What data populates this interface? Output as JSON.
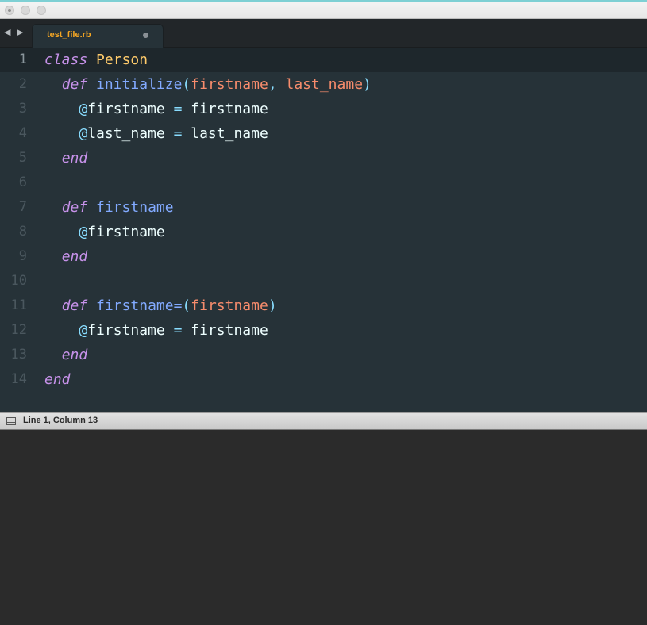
{
  "window": {
    "controls": [
      "close",
      "minimize",
      "zoom"
    ]
  },
  "tabbar": {
    "back_icon": "◀",
    "forward_icon": "▶",
    "active_tab": {
      "label": "test_file.rb",
      "modified": true
    }
  },
  "editor": {
    "current_line": 1,
    "lines": [
      {
        "n": "1",
        "tokens": [
          {
            "t": "kw",
            "v": "class"
          },
          {
            "t": "plain",
            "v": " "
          },
          {
            "t": "cls",
            "v": "Person"
          }
        ]
      },
      {
        "n": "2",
        "tokens": [
          {
            "t": "plain",
            "v": "  "
          },
          {
            "t": "kw",
            "v": "def"
          },
          {
            "t": "plain",
            "v": " "
          },
          {
            "t": "fn",
            "v": "initialize"
          },
          {
            "t": "punc",
            "v": "("
          },
          {
            "t": "param",
            "v": "firstname"
          },
          {
            "t": "punc",
            "v": ","
          },
          {
            "t": "plain",
            "v": " "
          },
          {
            "t": "param",
            "v": "last_name"
          },
          {
            "t": "punc",
            "v": ")"
          }
        ]
      },
      {
        "n": "3",
        "tokens": [
          {
            "t": "plain",
            "v": "    "
          },
          {
            "t": "ivar-at",
            "v": "@"
          },
          {
            "t": "plain",
            "v": "firstname "
          },
          {
            "t": "op",
            "v": "="
          },
          {
            "t": "plain",
            "v": " firstname"
          }
        ]
      },
      {
        "n": "4",
        "tokens": [
          {
            "t": "plain",
            "v": "    "
          },
          {
            "t": "ivar-at",
            "v": "@"
          },
          {
            "t": "plain",
            "v": "last_name "
          },
          {
            "t": "op",
            "v": "="
          },
          {
            "t": "plain",
            "v": " last_name"
          }
        ]
      },
      {
        "n": "5",
        "tokens": [
          {
            "t": "plain",
            "v": "  "
          },
          {
            "t": "kw",
            "v": "end"
          }
        ]
      },
      {
        "n": "6",
        "tokens": []
      },
      {
        "n": "7",
        "tokens": [
          {
            "t": "plain",
            "v": "  "
          },
          {
            "t": "kw",
            "v": "def"
          },
          {
            "t": "plain",
            "v": " "
          },
          {
            "t": "fn",
            "v": "firstname"
          }
        ]
      },
      {
        "n": "8",
        "tokens": [
          {
            "t": "plain",
            "v": "    "
          },
          {
            "t": "ivar-at",
            "v": "@"
          },
          {
            "t": "plain",
            "v": "firstname"
          }
        ]
      },
      {
        "n": "9",
        "tokens": [
          {
            "t": "plain",
            "v": "  "
          },
          {
            "t": "kw",
            "v": "end"
          }
        ]
      },
      {
        "n": "10",
        "tokens": []
      },
      {
        "n": "11",
        "tokens": [
          {
            "t": "plain",
            "v": "  "
          },
          {
            "t": "kw",
            "v": "def"
          },
          {
            "t": "plain",
            "v": " "
          },
          {
            "t": "fn",
            "v": "firstname="
          },
          {
            "t": "punc",
            "v": "("
          },
          {
            "t": "param",
            "v": "firstname"
          },
          {
            "t": "punc",
            "v": ")"
          }
        ]
      },
      {
        "n": "12",
        "tokens": [
          {
            "t": "plain",
            "v": "    "
          },
          {
            "t": "ivar-at",
            "v": "@"
          },
          {
            "t": "plain",
            "v": "firstname "
          },
          {
            "t": "op",
            "v": "="
          },
          {
            "t": "plain",
            "v": " firstname"
          }
        ]
      },
      {
        "n": "13",
        "tokens": [
          {
            "t": "plain",
            "v": "  "
          },
          {
            "t": "kw",
            "v": "end"
          }
        ]
      },
      {
        "n": "14",
        "tokens": [
          {
            "t": "kw",
            "v": "end"
          }
        ]
      }
    ]
  },
  "statusbar": {
    "position_text": "Line 1, Column 13"
  },
  "theme": {
    "editor_bg": "#263238",
    "keyword": "#c792ea",
    "class_name": "#ffcb6b",
    "function": "#82aaff",
    "parameter": "#f78c6c",
    "punctuation": "#89ddff",
    "tab_label": "#f5a623"
  }
}
